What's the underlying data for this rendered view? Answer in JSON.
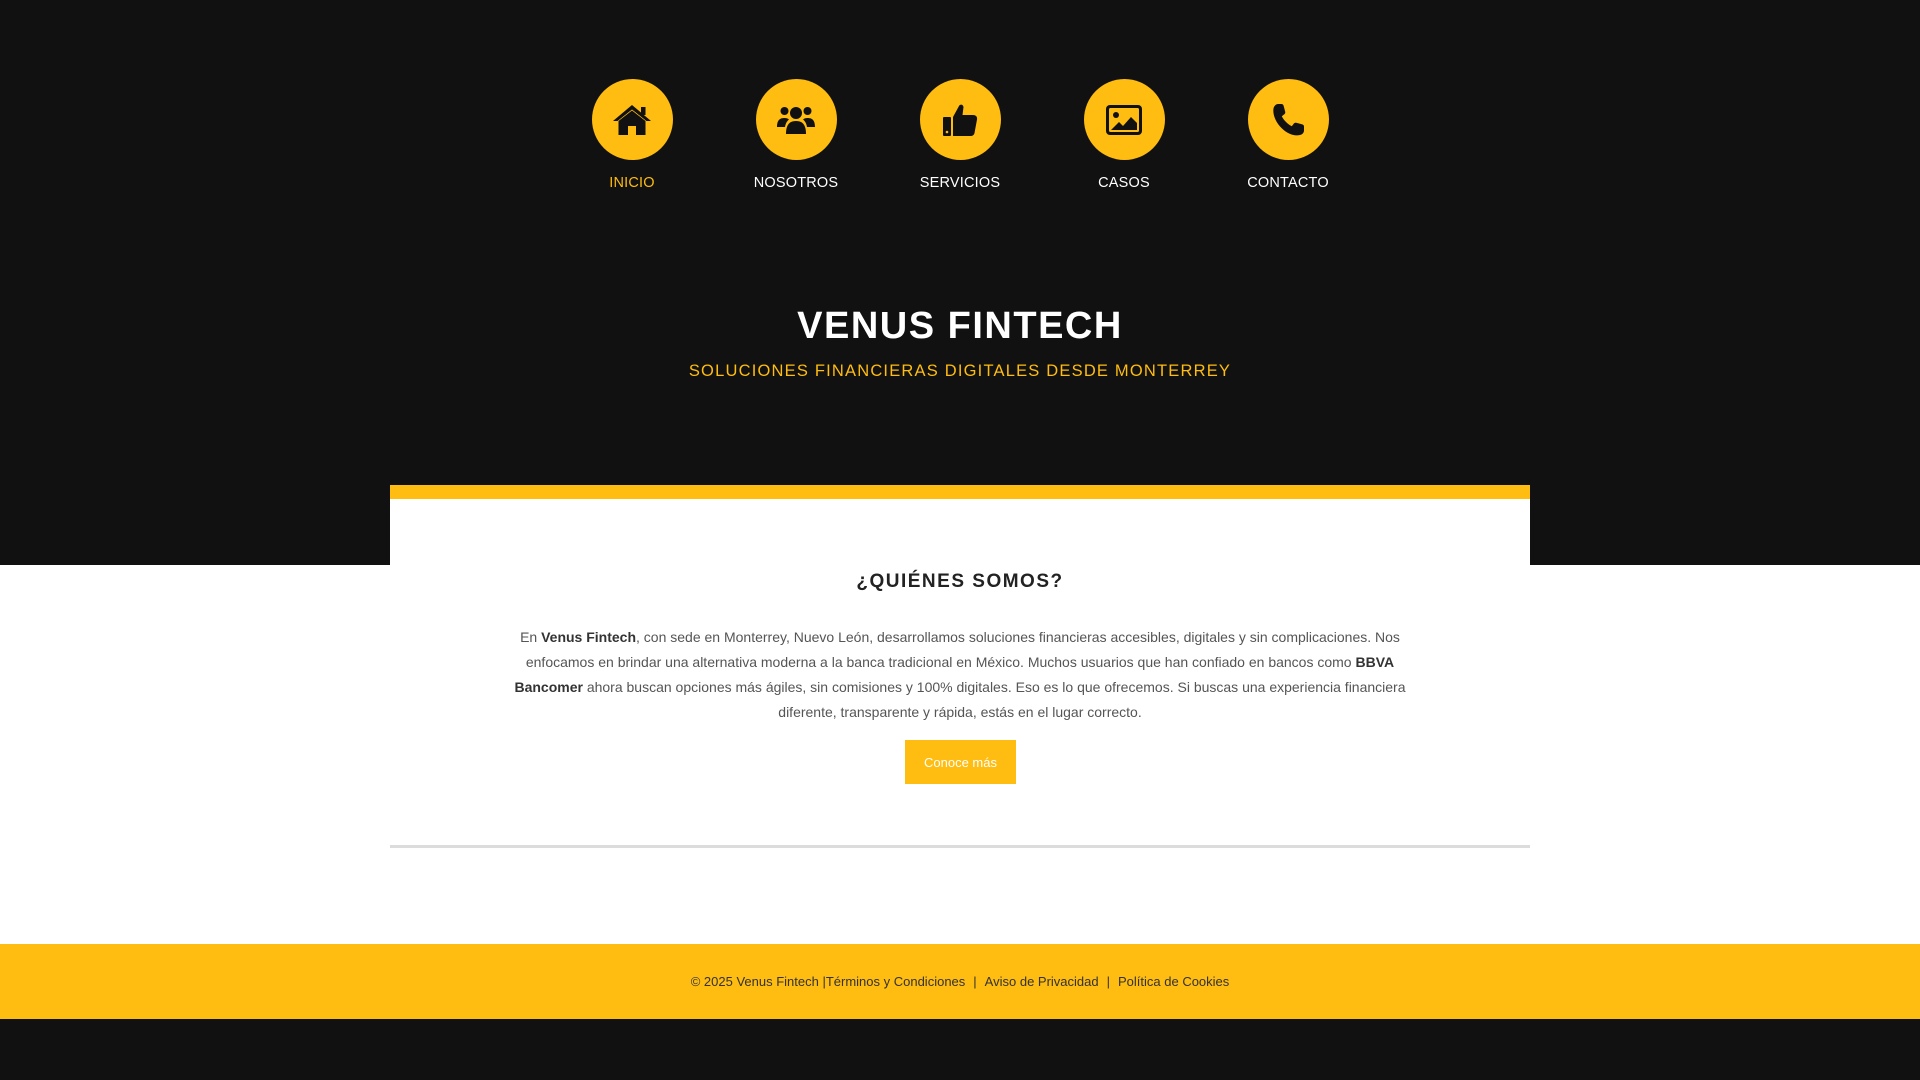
{
  "nav": {
    "items": [
      {
        "label": "INICIO",
        "icon": "home-icon",
        "active": true
      },
      {
        "label": "NOSOTROS",
        "icon": "users-icon",
        "active": false
      },
      {
        "label": "SERVICIOS",
        "icon": "thumbs-up-icon",
        "active": false
      },
      {
        "label": "CASOS",
        "icon": "image-icon",
        "active": false
      },
      {
        "label": "CONTACTO",
        "icon": "phone-icon",
        "active": false
      }
    ]
  },
  "hero": {
    "title": "VENUS FINTECH",
    "subtitle": "SOLUCIONES FINANCIERAS DIGITALES DESDE MONTERREY"
  },
  "about": {
    "title": "¿QUIÉNES SOMOS?",
    "text": {
      "p1": "En ",
      "brand": "Venus Fintech",
      "p2": ", con sede en Monterrey, Nuevo León, desarrollamos soluciones financieras accesibles, digitales y sin complicaciones. Nos enfocamos en brindar una alternativa moderna a la banca tradicional en México. Muchos usuarios que han confiado en bancos como ",
      "bank": "BBVA Bancomer",
      "p3": " ahora buscan opciones más ágiles, sin comisiones y 100% digitales. Eso es lo que ofrecemos. Si buscas una experiencia financiera diferente, transparente y rápida, estás en el lugar correcto."
    },
    "button_label": "Conoce más"
  },
  "footer": {
    "copyright": "© 2025 Venus Fintech | ",
    "terms": "Términos y Condiciones",
    "separator": "|",
    "privacy": "Aviso de Privacidad",
    "cookies": "Política de Cookies"
  },
  "colors": {
    "accent": "#FFBC11",
    "dark": "#111111",
    "white": "#FFFFFF"
  }
}
